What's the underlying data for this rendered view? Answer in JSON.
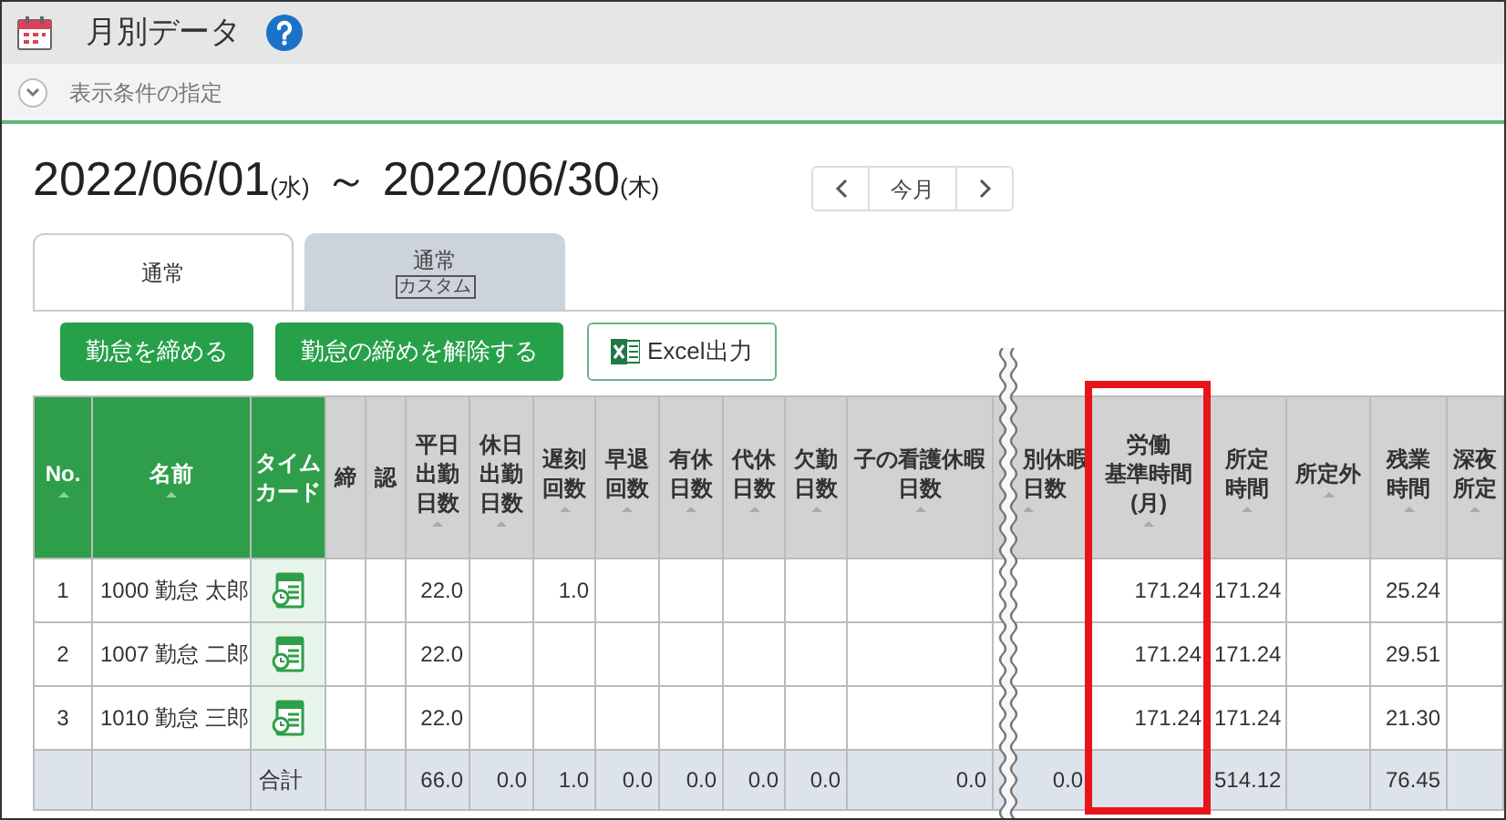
{
  "window": {
    "title": "月別データ"
  },
  "filter_toggle": {
    "label": "表示条件の指定",
    "expanded": false
  },
  "period": {
    "start": "2022/06/01",
    "start_day": "(水)",
    "separator": "～",
    "end": "2022/06/30",
    "end_day": "(木)"
  },
  "month_nav": {
    "current": "今月"
  },
  "tabs": [
    {
      "label": "通常",
      "selected": true
    },
    {
      "label": "通常",
      "badge": "カスタム",
      "selected": false
    }
  ],
  "buttons": [
    {
      "label": "勤怠を締める",
      "kind": "primary"
    },
    {
      "label": "勤怠の締めを解除する",
      "kind": "primary"
    },
    {
      "label": "Excel出力",
      "kind": "excel"
    }
  ],
  "table": {
    "columns": [
      {
        "lines": [
          "No."
        ],
        "kind": "key",
        "sortable": true,
        "highlighted": false
      },
      {
        "lines": [
          "名前"
        ],
        "kind": "key",
        "sortable": true,
        "highlighted": false
      },
      {
        "lines": [
          "タイム",
          "カード"
        ],
        "kind": "key",
        "sortable": false,
        "highlighted": false
      },
      {
        "lines": [
          "締"
        ],
        "kind": "data",
        "sortable": false,
        "highlighted": false
      },
      {
        "lines": [
          "認"
        ],
        "kind": "data",
        "sortable": false,
        "highlighted": false
      },
      {
        "lines": [
          "平日",
          "出勤",
          "日数"
        ],
        "kind": "data",
        "sortable": true,
        "highlighted": false
      },
      {
        "lines": [
          "休日",
          "出勤",
          "日数"
        ],
        "kind": "data",
        "sortable": true,
        "highlighted": false
      },
      {
        "lines": [
          "遅刻",
          "回数"
        ],
        "kind": "data",
        "sortable": true,
        "highlighted": false
      },
      {
        "lines": [
          "早退",
          "回数"
        ],
        "kind": "data",
        "sortable": true,
        "highlighted": false
      },
      {
        "lines": [
          "有休",
          "日数"
        ],
        "kind": "data",
        "sortable": true,
        "highlighted": false
      },
      {
        "lines": [
          "代休",
          "日数"
        ],
        "kind": "data",
        "sortable": true,
        "highlighted": false
      },
      {
        "lines": [
          "欠勤",
          "日数"
        ],
        "kind": "data",
        "sortable": true,
        "highlighted": false
      },
      {
        "lines": [
          "子の看護休暇",
          "日数"
        ],
        "kind": "data",
        "sortable": true,
        "highlighted": false
      },
      {
        "lines": [
          "別休暇",
          "日数"
        ],
        "kind": "data",
        "sortable": true,
        "highlighted": false
      },
      {
        "lines": [
          "労働",
          "基準時間",
          "(月)"
        ],
        "kind": "data",
        "sortable": true,
        "highlighted": true
      },
      {
        "lines": [
          "所定",
          "時間"
        ],
        "kind": "data",
        "sortable": true,
        "highlighted": false
      },
      {
        "lines": [
          "所定外"
        ],
        "kind": "data",
        "sortable": true,
        "highlighted": false
      },
      {
        "lines": [
          "残業",
          "時間"
        ],
        "kind": "data",
        "sortable": true,
        "highlighted": false
      },
      {
        "lines": [
          "深夜",
          "所定"
        ],
        "kind": "data",
        "sortable": true,
        "highlighted": false
      }
    ],
    "rows": [
      {
        "timecard": true,
        "cells": [
          "1",
          "1000 勤怠 太郎",
          "",
          "",
          "",
          "22.0",
          "",
          "1.0",
          "",
          "",
          "",
          "",
          "",
          "",
          "171.24",
          "171.24",
          "",
          "25.24",
          ""
        ]
      },
      {
        "timecard": true,
        "cells": [
          "2",
          "1007 勤怠 二郎",
          "",
          "",
          "",
          "22.0",
          "",
          "",
          "",
          "",
          "",
          "",
          "",
          "",
          "171.24",
          "171.24",
          "",
          "29.51",
          ""
        ]
      },
      {
        "timecard": true,
        "cells": [
          "3",
          "1010 勤怠 三郎",
          "",
          "",
          "",
          "22.0",
          "",
          "",
          "",
          "",
          "",
          "",
          "",
          "",
          "171.24",
          "171.24",
          "",
          "21.30",
          ""
        ]
      }
    ],
    "total": {
      "cells": [
        "",
        "",
        "合計",
        "",
        "",
        "66.0",
        "0.0",
        "1.0",
        "0.0",
        "0.0",
        "0.0",
        "0.0",
        "0.0",
        "0.0",
        "",
        "514.12",
        "",
        "76.45",
        ""
      ]
    }
  }
}
